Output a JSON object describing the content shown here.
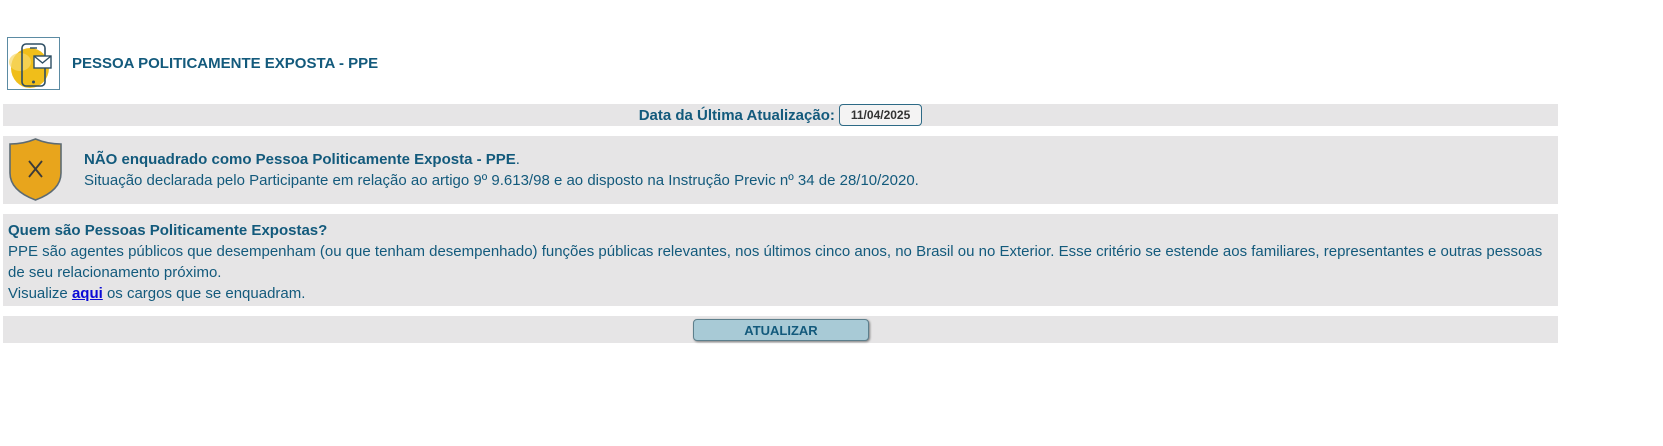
{
  "header": {
    "title": "PESSOA POLITICAMENTE EXPOSTA - PPE",
    "icon": "phone-mail-icon"
  },
  "update_date": {
    "label": "Data da Última Atualização:",
    "value": "11/04/2025"
  },
  "status": {
    "icon": "shield-x-icon",
    "title": "NÃO enquadrado como Pessoa Politicamente Exposta - PPE",
    "title_suffix": ".",
    "description": "Situação declarada pelo Participante em relação ao artigo 9º 9.613/98 e ao disposto na Instrução Previc nº 34 de 28/10/2020."
  },
  "info": {
    "heading": "Quem são Pessoas Politicamente Expostas?",
    "body": "PPE são agentes públicos que desempenham (ou que tenham desempenhado) funções públicas relevantes, nos últimos cinco anos, no Brasil ou no Exterior. Esse critério se estende aos familiares, representantes e outras pessoas de seu relacionamento próximo.",
    "link_prefix": "Visualize ",
    "link_text": "aqui",
    "link_suffix": " os cargos que se enquadram."
  },
  "actions": {
    "update_label": "ATUALIZAR"
  },
  "colors": {
    "primary": "#135a7c",
    "panel": "#e6e5e6",
    "shield": "#e8a51c",
    "button": "#a8cad6",
    "link": "#0a0ad6"
  }
}
